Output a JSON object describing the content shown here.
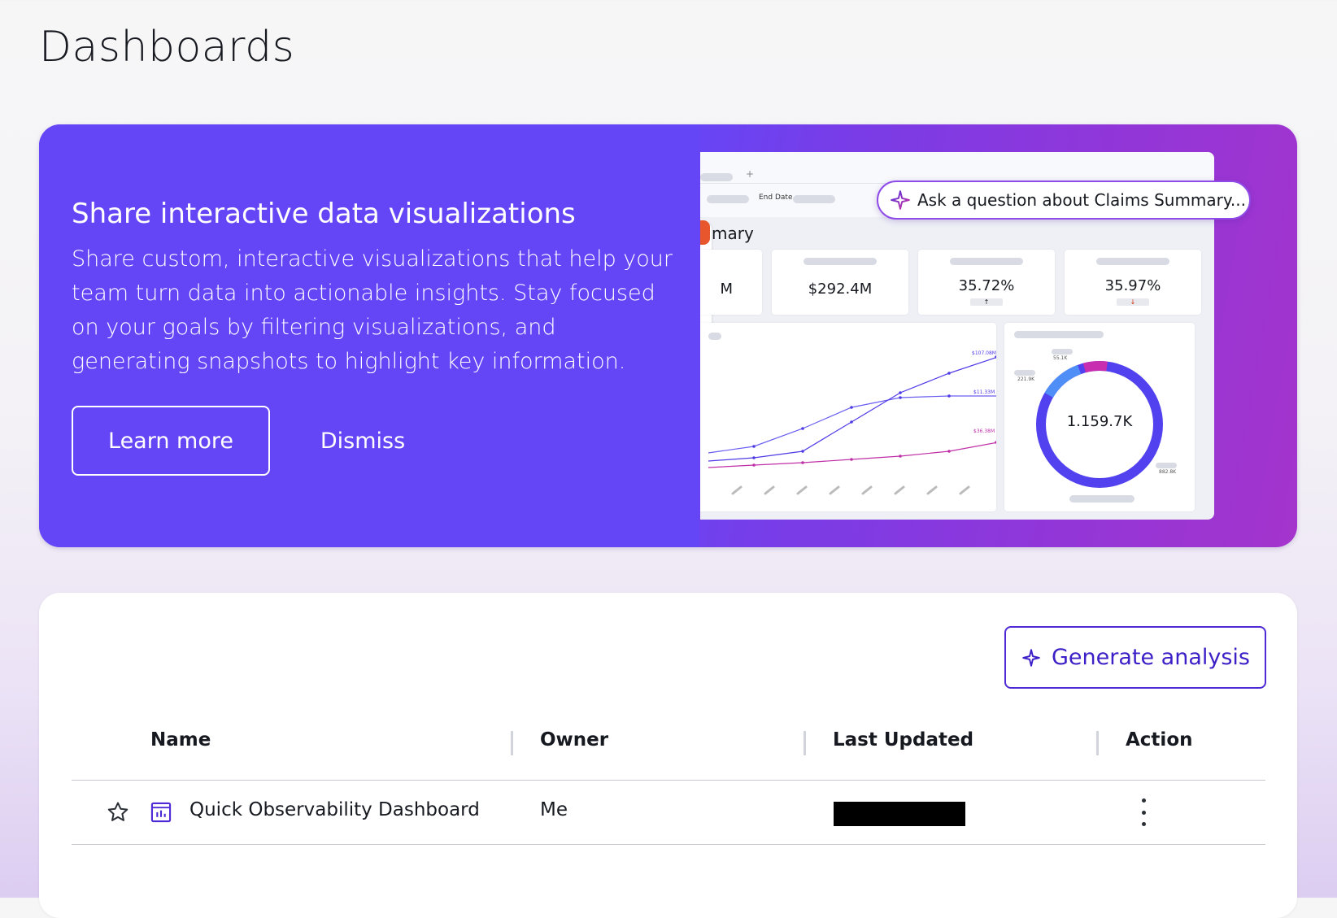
{
  "page": {
    "title": "Dashboards"
  },
  "banner": {
    "title": "Share interactive data visualizations",
    "body": "Share custom, interactive visualizations that help your team turn data into actionable insights. Stay focused on your goals by filtering visualizations, and generating snapshots to highlight key information.",
    "learn_more": "Learn more",
    "dismiss": "Dismiss",
    "preview": {
      "end_date_label": "End Date",
      "summary_title": "mary",
      "kpis": [
        "M",
        "$292.4M",
        "35.72%",
        "35.97%"
      ],
      "kpi_arrows": [
        "↑",
        "↓"
      ],
      "series_labels": [
        "$107.08M",
        "$11.33M",
        "$36.38M"
      ],
      "donut_total": "1.159.7K",
      "donut_labels": [
        "55.1K",
        "221.9K",
        "882.8K"
      ],
      "ask_question": "Ask a question about Claims Summary..."
    }
  },
  "list": {
    "generate_label": "Generate analysis",
    "columns": [
      "Name",
      "Owner",
      "Last Updated",
      "Action"
    ],
    "rows": [
      {
        "name": "Quick Observability Dashboard",
        "owner": "Me"
      }
    ]
  },
  "colors": {
    "brand": "#6546f7",
    "accent": "#4e2ad6",
    "gradient_end": "#a434cc"
  }
}
